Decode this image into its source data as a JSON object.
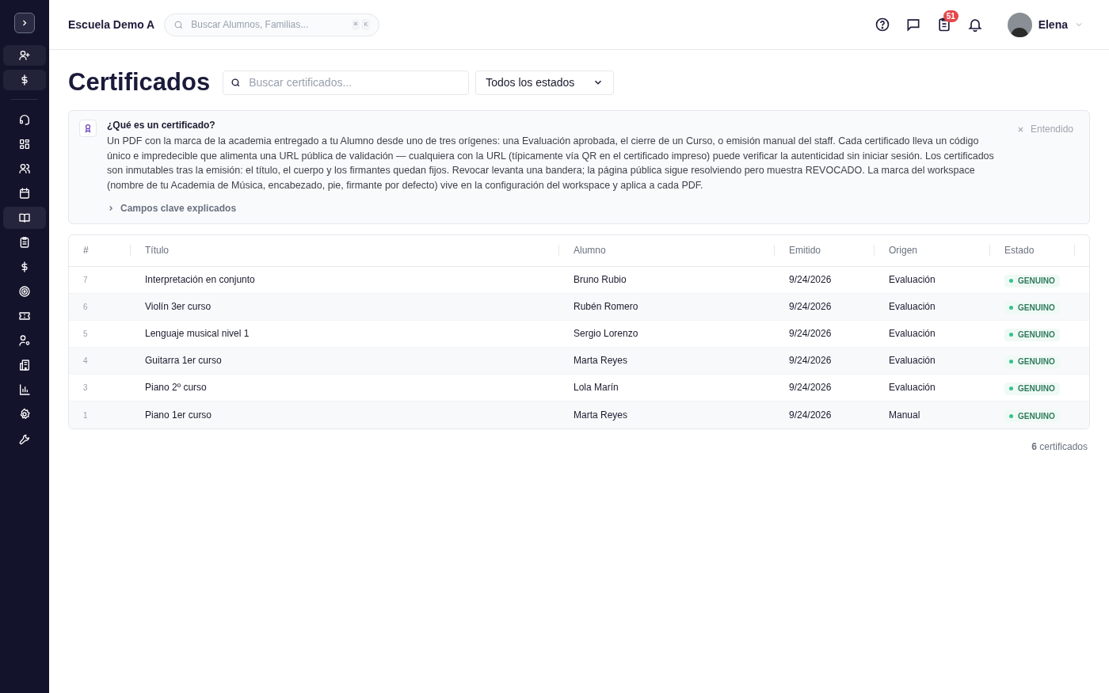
{
  "sidebar": {
    "items": [
      {
        "selected": false
      },
      {
        "selected": false
      },
      {
        "selected": false
      },
      {
        "selected": false
      },
      {
        "selected": true
      },
      {
        "selected": false
      },
      {
        "selected": false
      },
      {
        "selected": false
      },
      {
        "selected": false
      },
      {
        "selected": false
      },
      {
        "selected": false
      },
      {
        "selected": false
      },
      {
        "selected": false
      },
      {
        "selected": false
      }
    ]
  },
  "header": {
    "school": "Escuela Demo A",
    "search": {
      "placeholder": "Buscar Alumnos, Familias...",
      "keys": [
        "⌘",
        "K"
      ]
    },
    "tasks_badge": "51",
    "user": "Elena"
  },
  "page": {
    "title": "Certificados",
    "search": {
      "placeholder": "Buscar certificados..."
    },
    "status_filter": "Todos los estados"
  },
  "info": {
    "title": "¿Qué es un certificado?",
    "body": "Un PDF con la marca de la academia entregado a tu Alumno desde uno de tres orígenes: una Evaluación aprobada, el cierre de un Curso, o emisión manual del staff. Cada certificado lleva un código único e impredecible que alimenta una URL pública de validación — cualquiera con la URL (típicamente vía QR en el certificado impreso) puede verificar la autenticidad sin iniciar sesión. Los certificados son inmutables tras la emisión: el título, el cuerpo y los firmantes quedan fijos. Revocar levanta una bandera; la página pública sigue resolviendo pero muestra REVOCADO. La marca del workspace (nombre de tu Academia de Música, encabezado, pie, firmante por defecto) vive en la configuración del workspace y aplica a cada PDF.",
    "dismiss": "Entendido",
    "details": {
      "label": "Campos clave explicados",
      "expanded": false
    }
  },
  "table": {
    "columns": [
      "#",
      "Título",
      "Alumno",
      "Emitido",
      "Origen",
      "Estado"
    ],
    "rows": [
      {
        "num": "7",
        "title": "Interpretación en conjunto",
        "student": "Bruno Rubio",
        "issued": "9/24/2026",
        "origin": "Evaluación",
        "status": "GENUINO",
        "color": "#34c38f"
      },
      {
        "num": "6",
        "title": "Violín 3er curso",
        "student": "Rubén Romero",
        "issued": "9/24/2026",
        "origin": "Evaluación",
        "status": "GENUINO",
        "color": "#34c38f"
      },
      {
        "num": "5",
        "title": "Lenguaje musical nivel 1",
        "student": "Sergio Lorenzo",
        "issued": "9/24/2026",
        "origin": "Evaluación",
        "status": "GENUINO",
        "color": "#34c38f"
      },
      {
        "num": "4",
        "title": "Guitarra 1er curso",
        "student": "Marta Reyes",
        "issued": "9/24/2026",
        "origin": "Evaluación",
        "status": "GENUINO",
        "color": "#34c38f"
      },
      {
        "num": "3",
        "title": "Piano 2º curso",
        "student": "Lola Marín",
        "issued": "9/24/2026",
        "origin": "Evaluación",
        "status": "GENUINO",
        "color": "#34c38f"
      },
      {
        "num": "1",
        "title": "Piano 1er curso",
        "student": "Marta Reyes",
        "issued": "9/24/2026",
        "origin": "Manual",
        "status": "GENUINO",
        "color": "#34c38f"
      }
    ]
  },
  "footer": {
    "count": "**6** certificados"
  }
}
